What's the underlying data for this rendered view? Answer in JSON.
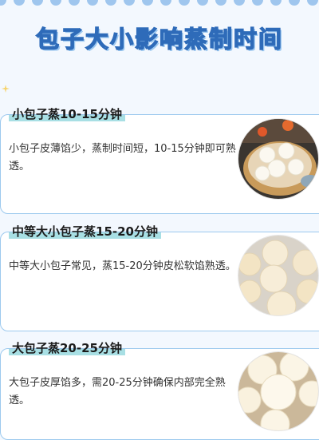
{
  "page": {
    "title": "包子大小影响蒸制时间"
  },
  "cards": [
    {
      "title": "小包子蒸10-15分钟",
      "text": "小包子皮薄馅少，蒸制时间短，10-15分钟即可熟透。",
      "photo": "steamer-small-buns-image"
    },
    {
      "title": "中等大小包子蒸15-20分钟",
      "text": "中等大小包子常见，蒸15-20分钟皮松软馅熟透。",
      "photo": "tray-medium-buns-image"
    },
    {
      "title": "大包子蒸20-25分钟",
      "text": "大包子皮厚馅多，需20-25分钟确保内部完全熟透。",
      "photo": "large-buns-image"
    }
  ],
  "colors": {
    "background": "#f3f8fe",
    "border": "#9cc9ee",
    "highlight": "#a8dfe4",
    "title_stroke": "#2e6bb9",
    "dots": "#9fc6ee"
  }
}
